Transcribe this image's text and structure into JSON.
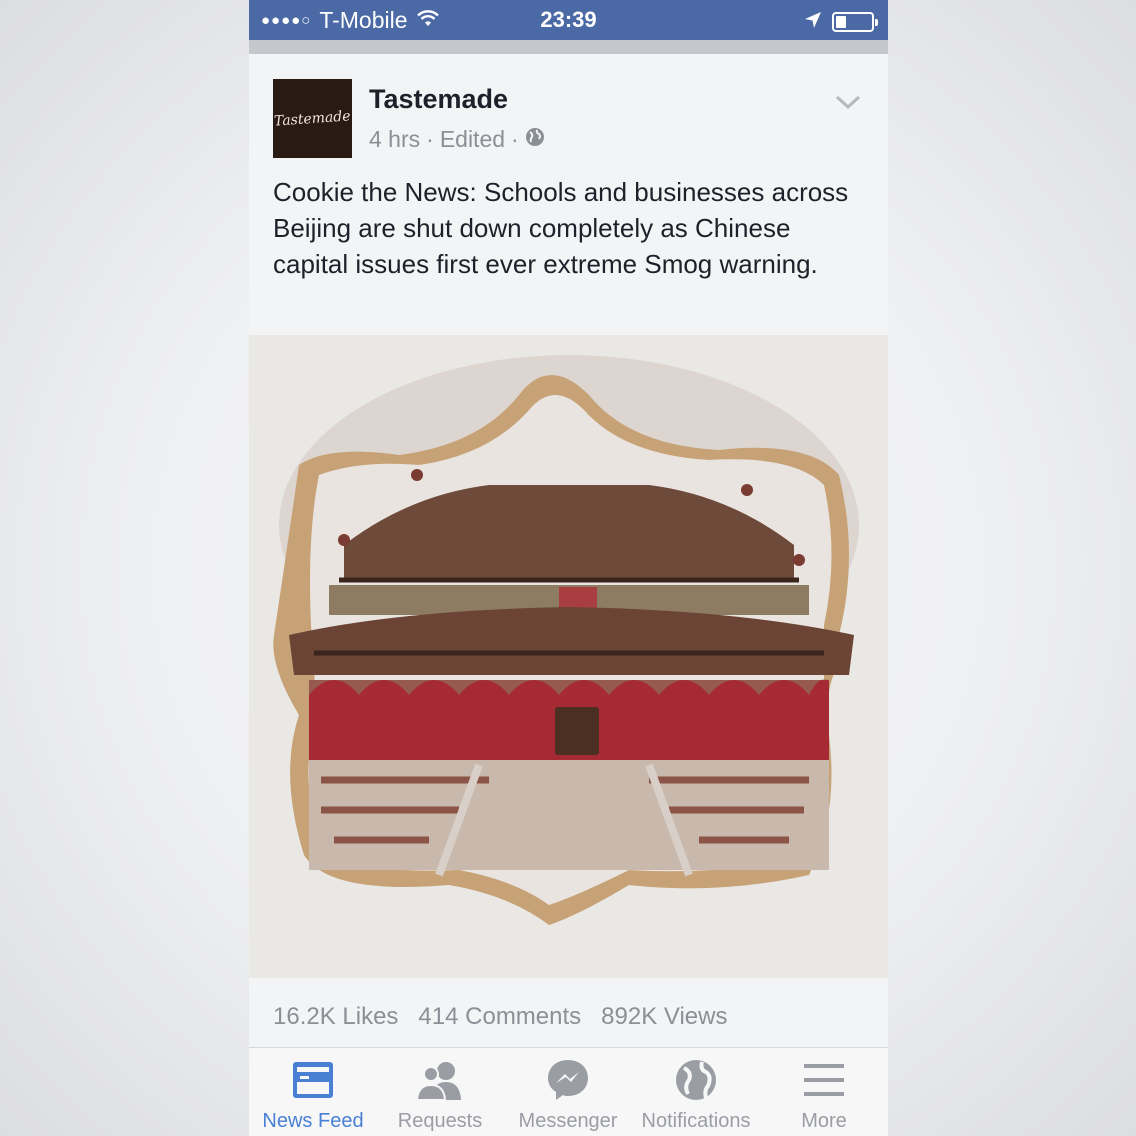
{
  "status_bar": {
    "signal_dots": "●●●●○",
    "carrier": "T-Mobile",
    "time": "23:39",
    "battery_level": 0.3,
    "icons": [
      "wifi-icon",
      "location-arrow-icon",
      "battery-icon"
    ]
  },
  "post": {
    "author": "Tastemade",
    "avatar_text": "Tastemade",
    "time": "4 hrs",
    "edited": "Edited",
    "separator": "·",
    "text": "Cookie the News: Schools and businesses across Beijing are shut down completely as Chinese capital issues first ever extreme Smog warning."
  },
  "stats": {
    "likes": "16.2K Likes",
    "comments": "414 Comments",
    "views": "892K Views"
  },
  "tabbar": {
    "items": [
      {
        "label": "News Feed",
        "icon": "news-feed-icon",
        "active": true
      },
      {
        "label": "Requests",
        "icon": "friend-requests-icon",
        "active": false
      },
      {
        "label": "Messenger",
        "icon": "messenger-icon",
        "active": false
      },
      {
        "label": "Notifications",
        "icon": "globe-icon",
        "active": false
      },
      {
        "label": "More",
        "icon": "hamburger-menu-icon",
        "active": false
      }
    ]
  },
  "colors": {
    "status_bar": "#4b69a4",
    "active_tab": "#4a80d4",
    "inactive_tab": "#9a9da3"
  }
}
